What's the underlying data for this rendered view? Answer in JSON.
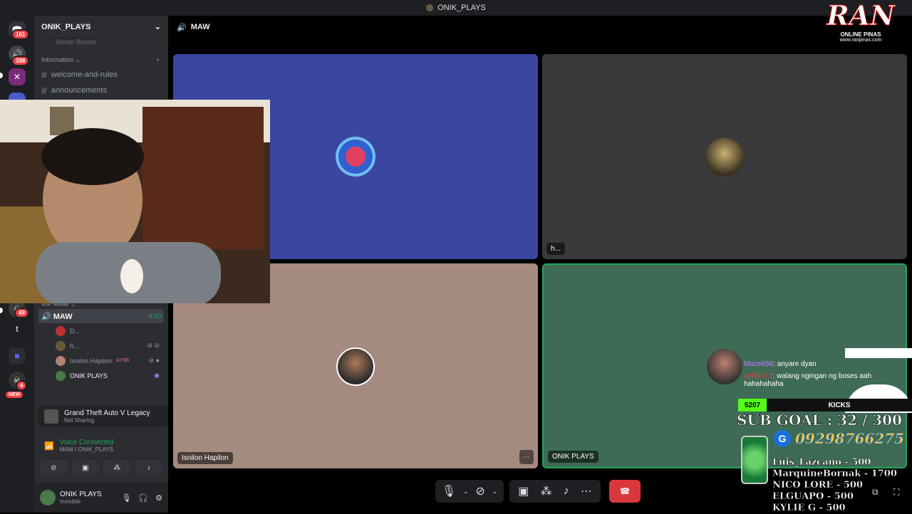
{
  "window": {
    "title": "ONIK_PLAYS"
  },
  "rail": {
    "badges": [
      "161",
      "398",
      "49",
      "4"
    ],
    "new_label": "NEW",
    "letter_item": "t"
  },
  "sidebar": {
    "server_name": "ONIK_PLAYS",
    "faded_item": "Server Boosts",
    "category_info": "Information",
    "channels": [
      "welcome-and-rules",
      "announcements"
    ],
    "category_vip": "VIP MAW",
    "voice_channel": {
      "name": "MAW",
      "timer": "0:00"
    },
    "voice_users": [
      {
        "name": "D...",
        "color": "#c03030"
      },
      {
        "name": "h...",
        "color": "#6b5a3a"
      },
      {
        "name": "Isnilon Hapilon",
        "color": "#b08070",
        "tag": "AYSB"
      },
      {
        "name": "ONIK PLAYS",
        "color": "#4a7a4a"
      }
    ]
  },
  "activity": {
    "game": "Grand Theft Auto V Legacy",
    "status": "Not Sharing"
  },
  "voice": {
    "status": "Voice Connected",
    "location": "MAW / ONIK_PLAYS"
  },
  "user": {
    "name": "ONIK PLAYS",
    "status": "Invisible"
  },
  "main": {
    "channel": "MAW",
    "tiles": [
      {
        "name": "",
        "color": "#3a46a0"
      },
      {
        "name": "h...",
        "color": "#3a3a3a"
      },
      {
        "name": "Isnilon Hapilon",
        "color": "#a58a80"
      },
      {
        "name": "ONIK PLAYS",
        "color": "#3e6b55"
      }
    ]
  },
  "overlay": {
    "logo_text": "RAN",
    "logo_sub": "ONLINE PINAS",
    "logo_url": "www.ranpinas.com",
    "chat": [
      {
        "user": "Maze656",
        "msg": ": anyare dyan",
        "color": "#c080ff"
      },
      {
        "user": "ayfk2377",
        "msg": ": walang ngingan ng boses aah hahahahaha",
        "color": "#e04040"
      }
    ],
    "kicks_count": "5207",
    "kicks_label": "KICKS",
    "sub_goal": "SUB GOAL : 32 / 300",
    "gcash": "09298766275",
    "donors": [
      "Luis_Lazcano - 500",
      "MarquineBornak - 1700",
      "NICO LORE - 500",
      "ELGUAPO - 500",
      "KYLIE G - 500"
    ]
  }
}
